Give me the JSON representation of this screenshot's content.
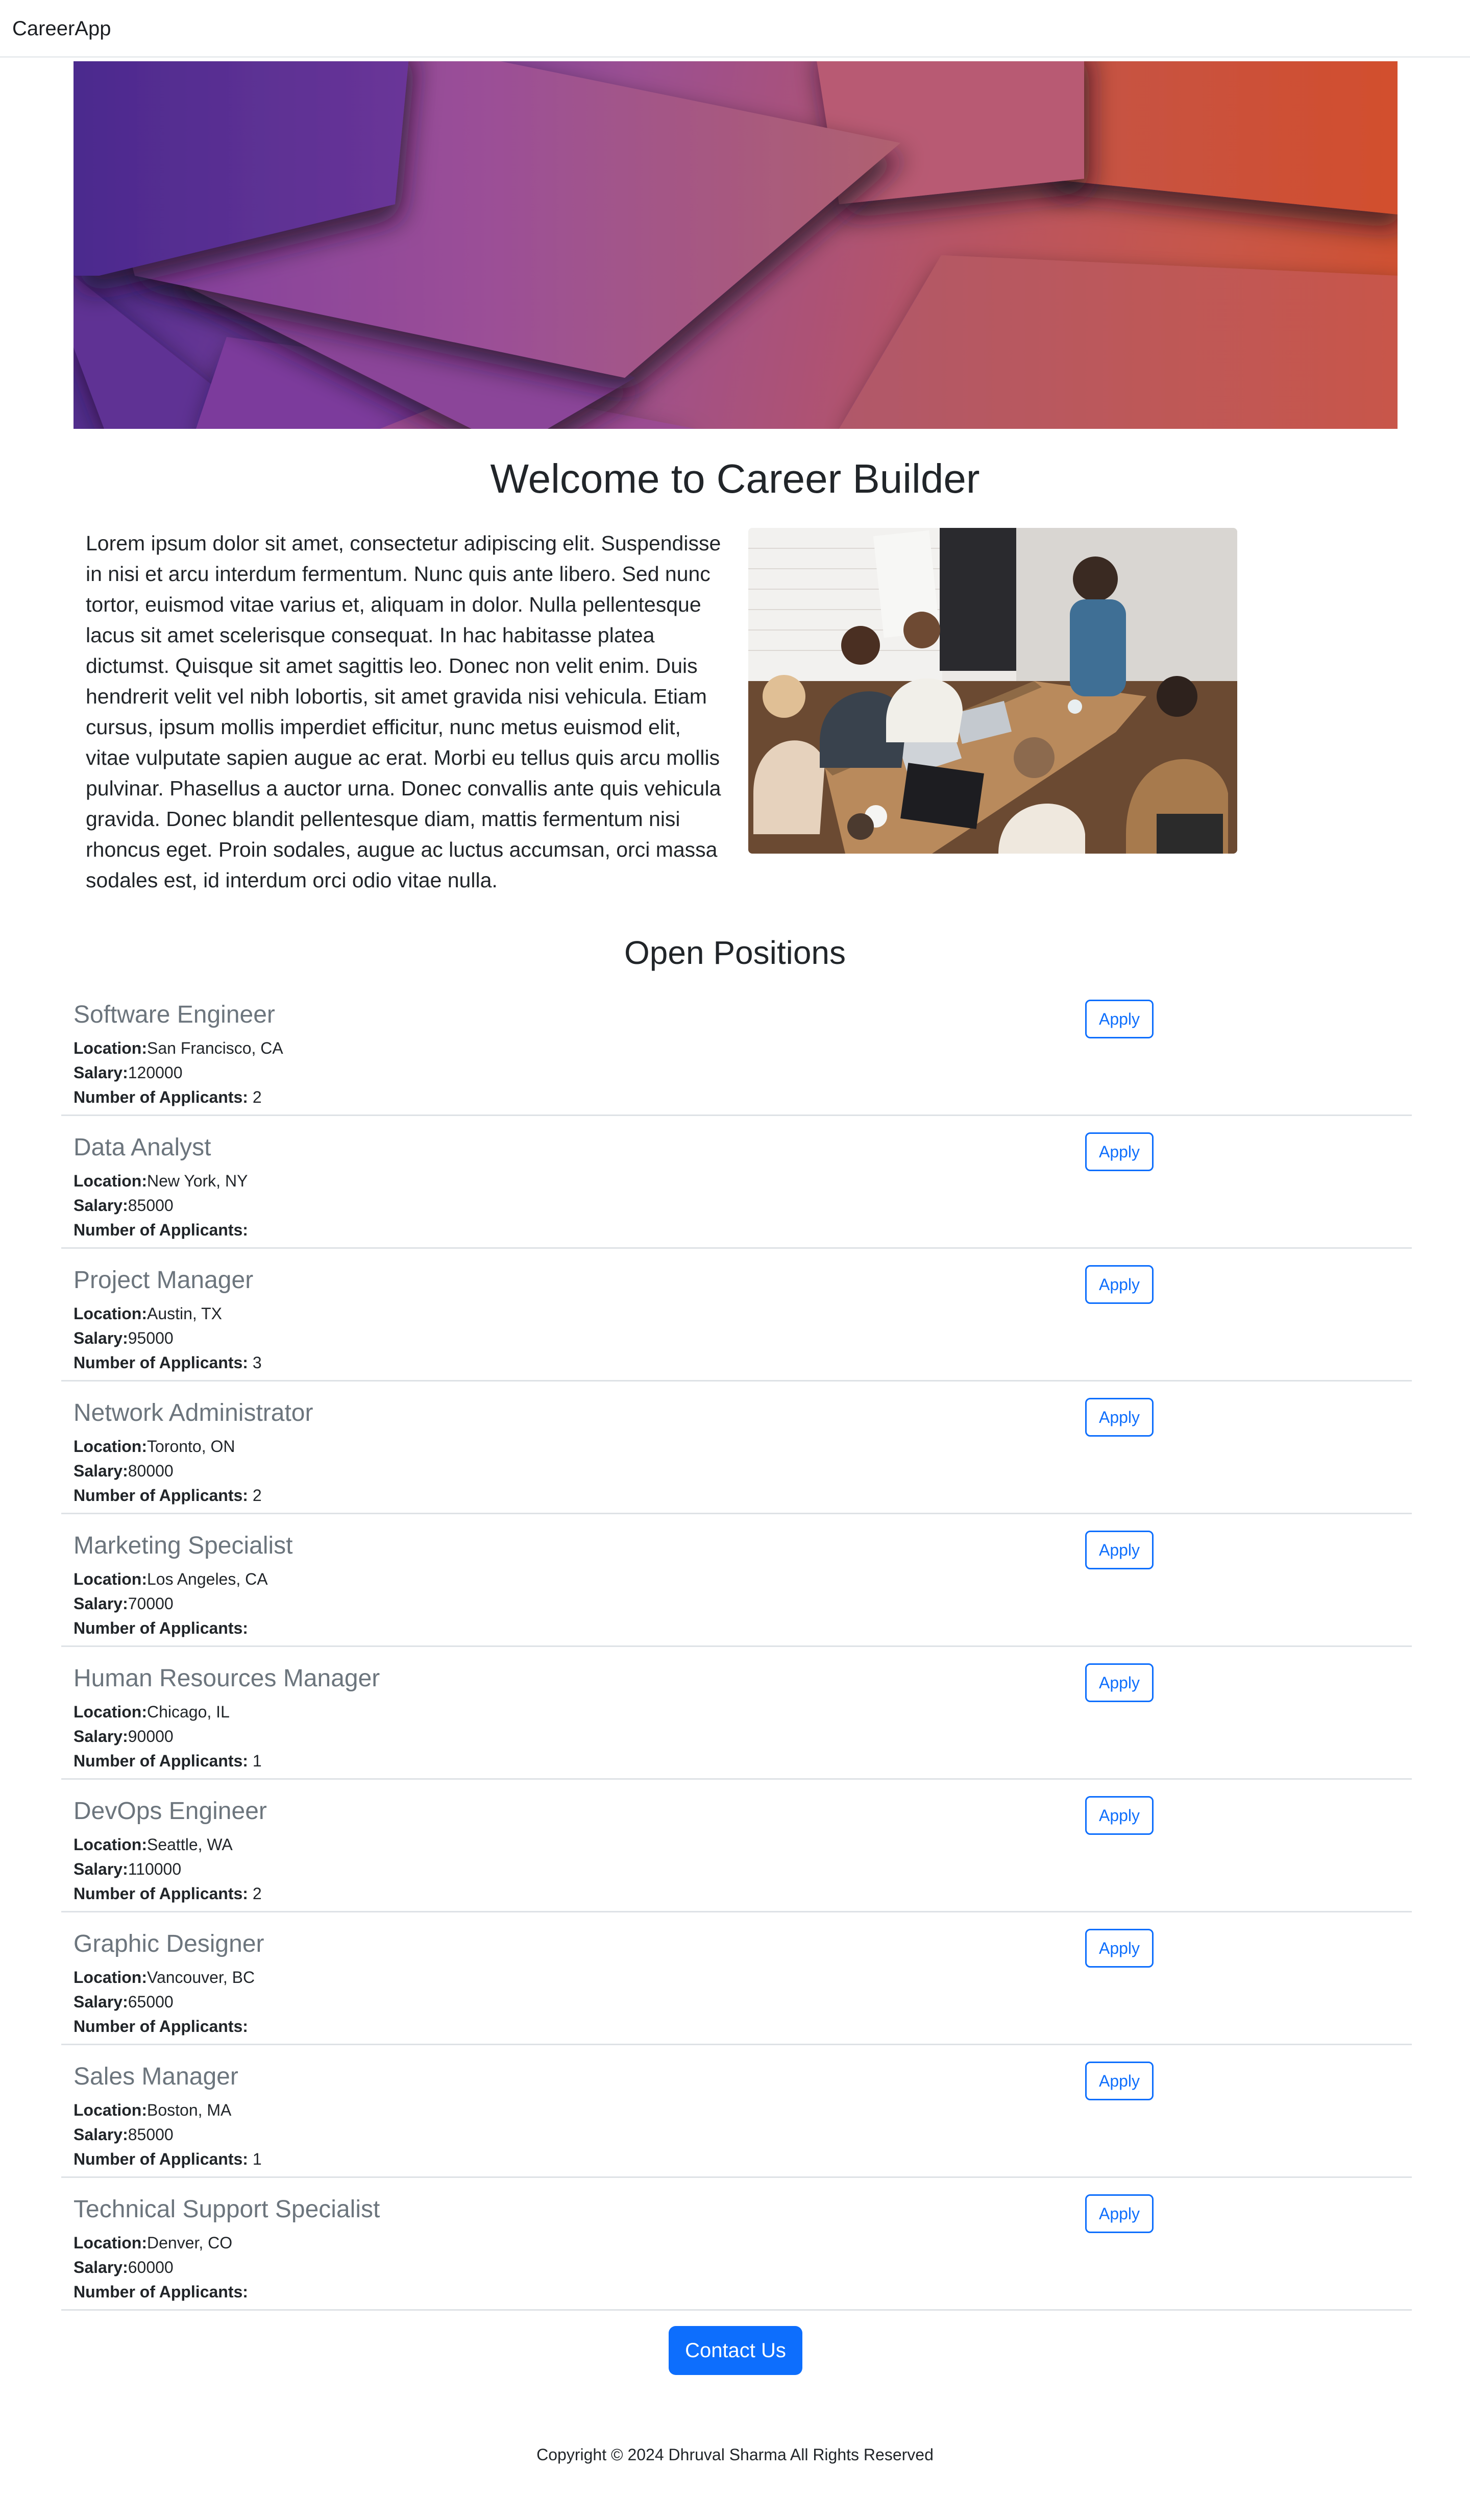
{
  "navbar": {
    "brand": "CareerApp"
  },
  "welcome": {
    "title": "Welcome to Career Builder",
    "text": "Lorem ipsum dolor sit amet, consectetur adipiscing elit. Suspendisse in nisi et arcu interdum fermentum. Nunc quis ante libero. Sed nunc tortor, euismod vitae varius et, aliquam in dolor. Nulla pellentesque lacus sit amet scelerisque consequat. In hac habitasse platea dictumst. Quisque sit amet sagittis leo. Donec non velit enim. Duis hendrerit velit vel nibh lobortis, sit amet gravida nisi vehicula. Etiam cursus, ipsum mollis imperdiet efficitur, nunc metus euismod elit, vitae vulputate sapien augue ac erat. Morbi eu tellus quis arcu mollis pulvinar. Phasellus a auctor urna. Donec convallis ante quis vehicula gravida. Donec blandit pellentesque diam, mattis fermentum nisi rhoncus eget. Proin sodales, augue ac luctus accumsan, orci massa sodales est, id interdum orci odio vitae nulla."
  },
  "positions": {
    "title": "Open Positions",
    "location_label": "Location:",
    "salary_label": "Salary:",
    "applicants_label": "Number of Applicants:",
    "apply_label": "Apply",
    "jobs": [
      {
        "title": "Software Engineer",
        "location": "San Francisco, CA",
        "salary": "120000",
        "applicants": "2"
      },
      {
        "title": "Data Analyst",
        "location": "New York, NY",
        "salary": "85000",
        "applicants": ""
      },
      {
        "title": "Project Manager",
        "location": "Austin, TX",
        "salary": "95000",
        "applicants": "3"
      },
      {
        "title": "Network Administrator",
        "location": "Toronto, ON",
        "salary": "80000",
        "applicants": "2"
      },
      {
        "title": "Marketing Specialist",
        "location": "Los Angeles, CA",
        "salary": "70000",
        "applicants": ""
      },
      {
        "title": "Human Resources Manager",
        "location": "Chicago, IL",
        "salary": "90000",
        "applicants": "1"
      },
      {
        "title": "DevOps Engineer",
        "location": "Seattle, WA",
        "salary": "110000",
        "applicants": "2"
      },
      {
        "title": "Graphic Designer",
        "location": "Vancouver, BC",
        "salary": "65000",
        "applicants": ""
      },
      {
        "title": "Sales Manager",
        "location": "Boston, MA",
        "salary": "85000",
        "applicants": "1"
      },
      {
        "title": "Technical Support Specialist",
        "location": "Denver, CO",
        "salary": "60000",
        "applicants": ""
      }
    ]
  },
  "contact": {
    "label": "Contact Us"
  },
  "footer": {
    "copyright": "Copyright © 2024 Dhruval Sharma All Rights Reserved"
  }
}
